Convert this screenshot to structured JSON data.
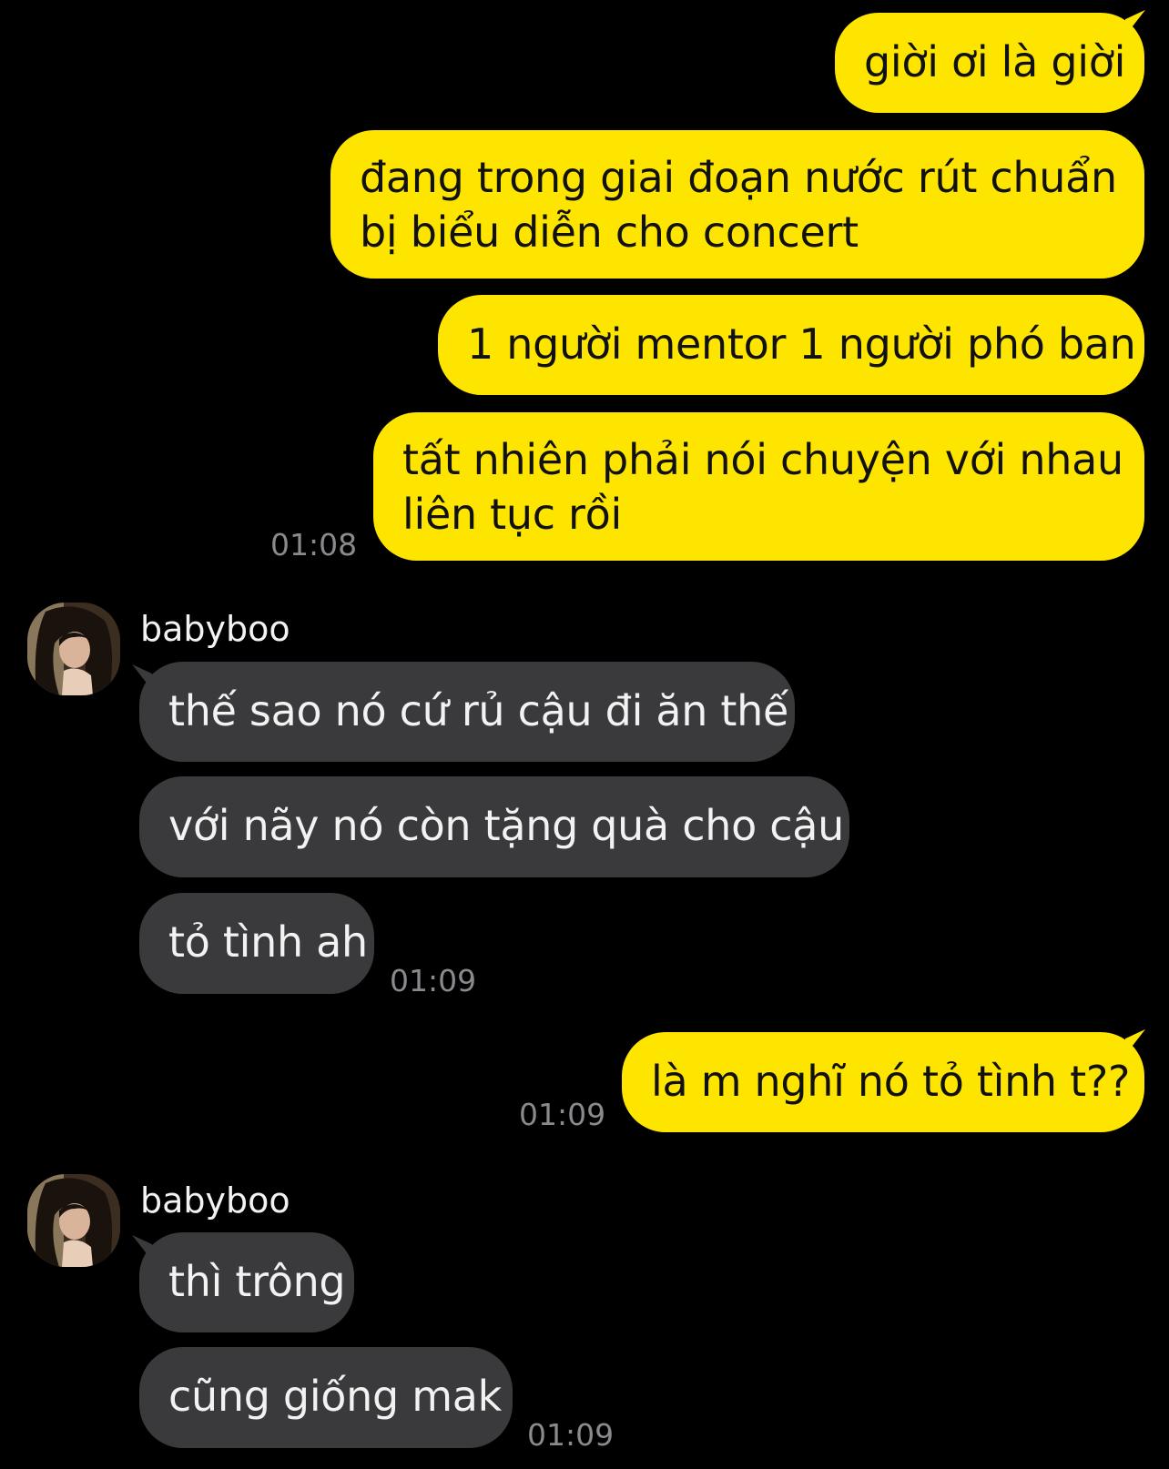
{
  "contact": {
    "name": "babyboo"
  },
  "messages": {
    "out1": "giời ơi là giời",
    "out2_l1": "đang trong giai đoạn nước rút chuẩn",
    "out2_l2": "bị biểu diễn cho concert",
    "out3": "1 người mentor 1 người phó ban",
    "out4_l1": "tất nhiên phải nói chuyện với nhau",
    "out4_l2": "liên tục rồi",
    "in1": "thế sao nó cứ rủ cậu đi ăn thế",
    "in2": "với nãy nó còn tặng quà cho cậu",
    "in3": "tỏ tình ah",
    "out5": "là m nghĩ nó tỏ tình t??",
    "in4": "thì trông",
    "in5": "cũng giống mak"
  },
  "times": {
    "t1": "01:08",
    "t2": "01:09",
    "t3": "01:09",
    "t4": "01:09"
  },
  "colors": {
    "outgoing_bubble": "#FEE500",
    "incoming_bubble": "#3a3a3c",
    "background": "#000000",
    "timestamp": "#8a8a8e"
  }
}
